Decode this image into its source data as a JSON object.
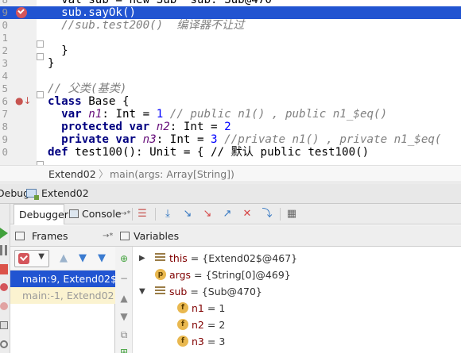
{
  "editor": {
    "line_numbers": [
      "8",
      "9",
      "0",
      "1",
      "2",
      "3",
      "4",
      "5",
      "6",
      "7",
      "8",
      "9",
      "0"
    ],
    "lines": [
      {
        "kind": "plain",
        "text": "  val sub = new Sub  sub: Sub@470"
      },
      {
        "kind": "exec",
        "text": "  sub.sayOk()"
      },
      {
        "kind": "comment",
        "text": "  //sub.test200()  编译器不让过"
      },
      {
        "kind": "empty",
        "text": ""
      },
      {
        "kind": "plain",
        "text": "  }"
      },
      {
        "kind": "plain",
        "text": "}"
      },
      {
        "kind": "empty",
        "text": ""
      },
      {
        "kind": "comment",
        "text": "// 父类(基类)"
      },
      {
        "kind": "classdecl",
        "kw": "class",
        "text": " Base {"
      },
      {
        "kind": "field",
        "kw": "var",
        "name": "n1",
        "rest": ": Int = ",
        "num": "1",
        "cmt": " // public n1() , public n1_$eq()"
      },
      {
        "kind": "field",
        "kw": "protected var",
        "name": "n2",
        "rest": ": Int = ",
        "num": "2",
        "cmt": ""
      },
      {
        "kind": "field",
        "kw": "private var",
        "name": "n3",
        "rest": ": Int = ",
        "num": "3",
        "cmt": " //private n1() , private n1_$eq("
      },
      {
        "kind": "def",
        "kw": "def",
        "text": " test100(): Unit = { // 默认 public test100()"
      }
    ]
  },
  "breadcrumb": {
    "crumb1": "Extend02",
    "separator": "〉",
    "crumb2": "main(args: Array[String])"
  },
  "debug_tab": {
    "label": "Debug",
    "config_name": "Extend02"
  },
  "subtabs": {
    "debugger": "Debugger",
    "console": "Console",
    "pin": "→*"
  },
  "toolbar_icons": [
    "show-execution-point-icon",
    "step-over-icon",
    "step-into-icon",
    "force-step-into-icon",
    "step-out-icon",
    "drop-frame-icon",
    "run-to-cursor-icon",
    "evaluate-expression-icon"
  ],
  "frames": {
    "title": "Frames",
    "pin": "→*",
    "items": [
      "main:9, Extend02$ (c",
      "main:-1, Extend02 (c"
    ]
  },
  "variables": {
    "title": "Variables",
    "items": [
      {
        "icon": "field",
        "expandable": true,
        "expanded": false,
        "name": "this",
        "value": "= {Extend02$@467}"
      },
      {
        "icon": "param",
        "expandable": false,
        "expanded": false,
        "name": "args",
        "value": "= {String[0]@469}"
      },
      {
        "icon": "field",
        "expandable": true,
        "expanded": true,
        "name": "sub",
        "value": "= {Sub@470}"
      },
      {
        "icon": "f",
        "expandable": false,
        "expanded": false,
        "name": "n1",
        "value": "= 1"
      },
      {
        "icon": "f",
        "expandable": false,
        "expanded": false,
        "name": "n2",
        "value": "= 2"
      },
      {
        "icon": "f",
        "expandable": false,
        "expanded": false,
        "name": "n3",
        "value": "= 3"
      }
    ],
    "badge_p": "p",
    "badge_f": "f"
  },
  "colors": {
    "selection": "#2154d1",
    "breakpoint": "#d4555b",
    "keyword": "#000080",
    "number": "#0000ff",
    "comment": "#808080",
    "instance_var": "#660e7a",
    "var_name": "#800000"
  }
}
